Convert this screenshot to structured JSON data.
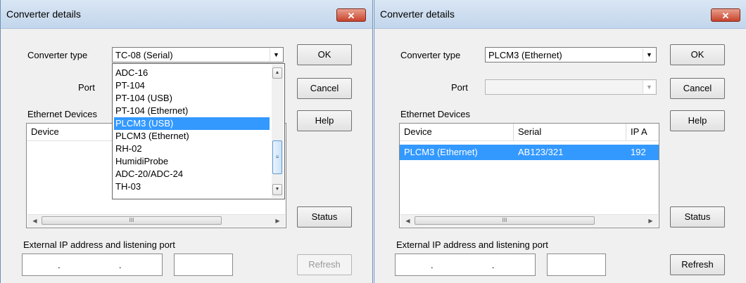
{
  "left": {
    "title": "Converter details",
    "close_label": "✕",
    "converter_type_label": "Converter type",
    "converter_type_value": "TC-08 (Serial)",
    "port_label": "Port",
    "ethernet_label": "Ethernet Devices",
    "list_columns": [
      "Device"
    ],
    "external_ip_label": "External IP address and listening port",
    "dropdown_options": [
      "ADC-16",
      "PT-104",
      "PT-104 (USB)",
      "PT-104 (Ethernet)",
      "PLCM3 (USB)",
      "PLCM3 (Ethernet)",
      "RH-02",
      "HumidiProbe",
      "ADC-20/ADC-24",
      "TH-03"
    ],
    "dropdown_selected": "PLCM3 (USB)",
    "buttons": {
      "ok": "OK",
      "cancel": "Cancel",
      "help": "Help",
      "status": "Status",
      "refresh": "Refresh"
    },
    "scroll_grip": "III",
    "ip_dots": ".  .  ."
  },
  "right": {
    "title": "Converter details",
    "close_label": "✕",
    "converter_type_label": "Converter type",
    "converter_type_value": "PLCM3 (Ethernet)",
    "port_label": "Port",
    "port_value": "",
    "ethernet_label": "Ethernet Devices",
    "list_columns": [
      "Device",
      "Serial",
      "IP A"
    ],
    "rows": [
      {
        "device": "PLCM3 (Ethernet)",
        "serial": "AB123/321",
        "ip": "192"
      }
    ],
    "external_ip_label": "External IP address and listening port",
    "buttons": {
      "ok": "OK",
      "cancel": "Cancel",
      "help": "Help",
      "status": "Status",
      "refresh": "Refresh"
    },
    "scroll_grip": "III",
    "ip_dots": ".  .  ."
  },
  "colors": {
    "selection": "#3399ff",
    "close_button": "#c8432c",
    "title_bar": "#c3d6ec"
  }
}
